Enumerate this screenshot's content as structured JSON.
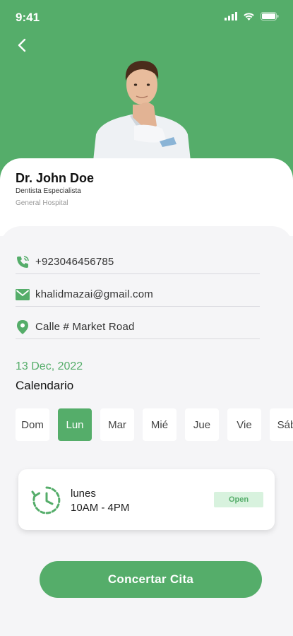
{
  "status_bar": {
    "time": "9:41"
  },
  "doctor": {
    "name": "Dr. John Doe",
    "title": "Dentista Especialista",
    "hospital": "General Hospital"
  },
  "contact": {
    "phone": "+923046456785",
    "email": "khalidmazai@gmail.com",
    "address": "Calle # Market Road"
  },
  "calendar": {
    "date": "13 Dec, 2022",
    "label": "Calendario",
    "days": [
      "Dom",
      "Lun",
      "Mar",
      "Mié",
      "Jue",
      "Vie",
      "Sáb"
    ],
    "selected_day": "Lun"
  },
  "hours": {
    "day": "lunes",
    "time": "10AM - 4PM",
    "status": "Open"
  },
  "cta_label": "Concertar Cita",
  "colors": {
    "primary": "#55ad6a",
    "badge_bg": "#d8f2de"
  }
}
